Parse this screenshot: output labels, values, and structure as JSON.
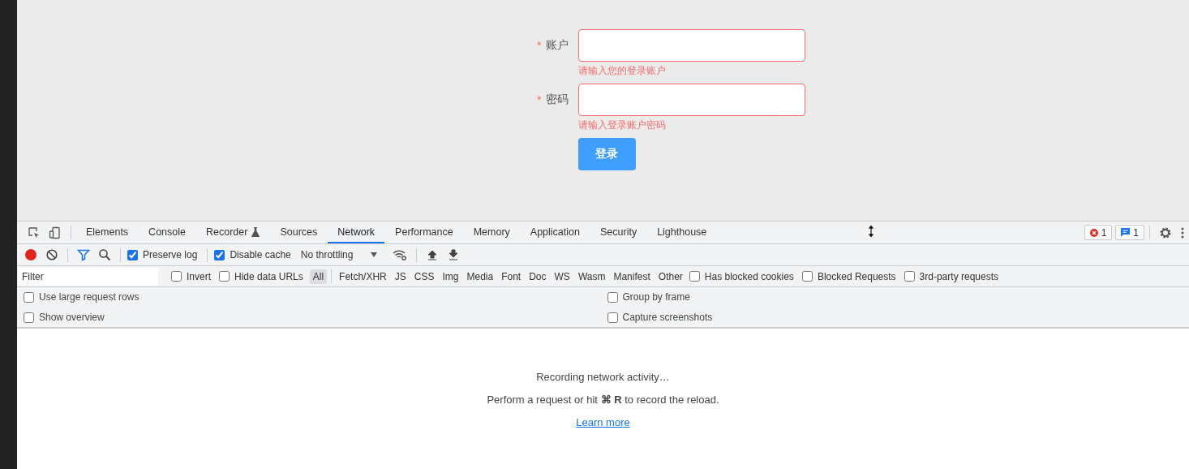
{
  "page": {
    "form": {
      "fields": [
        {
          "label": "账户",
          "required_mark": "*",
          "error": "请输入您的登录账户"
        },
        {
          "label": "密码",
          "required_mark": "*",
          "error": "请输入登录账户密码"
        }
      ],
      "submit": "登录"
    }
  },
  "devtools": {
    "tabs": [
      {
        "label": "Elements",
        "selected": false,
        "experimental": false
      },
      {
        "label": "Console",
        "selected": false,
        "experimental": false
      },
      {
        "label": "Recorder",
        "selected": false,
        "experimental": true
      },
      {
        "label": "Sources",
        "selected": false,
        "experimental": false
      },
      {
        "label": "Network",
        "selected": true,
        "experimental": false
      },
      {
        "label": "Performance",
        "selected": false,
        "experimental": false
      },
      {
        "label": "Memory",
        "selected": false,
        "experimental": false
      },
      {
        "label": "Application",
        "selected": false,
        "experimental": false
      },
      {
        "label": "Security",
        "selected": false,
        "experimental": false
      },
      {
        "label": "Lighthouse",
        "selected": false,
        "experimental": false
      }
    ],
    "error_count": "1",
    "message_count": "1",
    "toolbar": {
      "recording": true,
      "preserve_log": {
        "label": "Preserve log",
        "checked": true
      },
      "disable_cache": {
        "label": "Disable cache",
        "checked": true
      },
      "throttling": "No throttling"
    },
    "filter": {
      "placeholder": "Filter",
      "invert": {
        "label": "Invert",
        "checked": false
      },
      "hide_data_urls": {
        "label": "Hide data URLs",
        "checked": false
      },
      "types": [
        {
          "label": "All",
          "selected": true
        },
        {
          "label": "Fetch/XHR",
          "selected": false
        },
        {
          "label": "JS",
          "selected": false
        },
        {
          "label": "CSS",
          "selected": false
        },
        {
          "label": "Img",
          "selected": false
        },
        {
          "label": "Media",
          "selected": false
        },
        {
          "label": "Font",
          "selected": false
        },
        {
          "label": "Doc",
          "selected": false
        },
        {
          "label": "WS",
          "selected": false
        },
        {
          "label": "Wasm",
          "selected": false
        },
        {
          "label": "Manifest",
          "selected": false
        },
        {
          "label": "Other",
          "selected": false
        }
      ],
      "extra": [
        {
          "label": "Has blocked cookies",
          "checked": false
        },
        {
          "label": "Blocked Requests",
          "checked": false
        },
        {
          "label": "3rd-party requests",
          "checked": false
        }
      ]
    },
    "options": {
      "left": [
        {
          "label": "Use large request rows",
          "checked": false
        },
        {
          "label": "Show overview",
          "checked": false
        }
      ],
      "right": [
        {
          "label": "Group by frame",
          "checked": false
        },
        {
          "label": "Capture screenshots",
          "checked": false
        }
      ]
    },
    "empty": {
      "title": "Recording network activity…",
      "text": "Perform a request or hit **⌘ R** to record the reload.",
      "link": "Learn more"
    }
  }
}
